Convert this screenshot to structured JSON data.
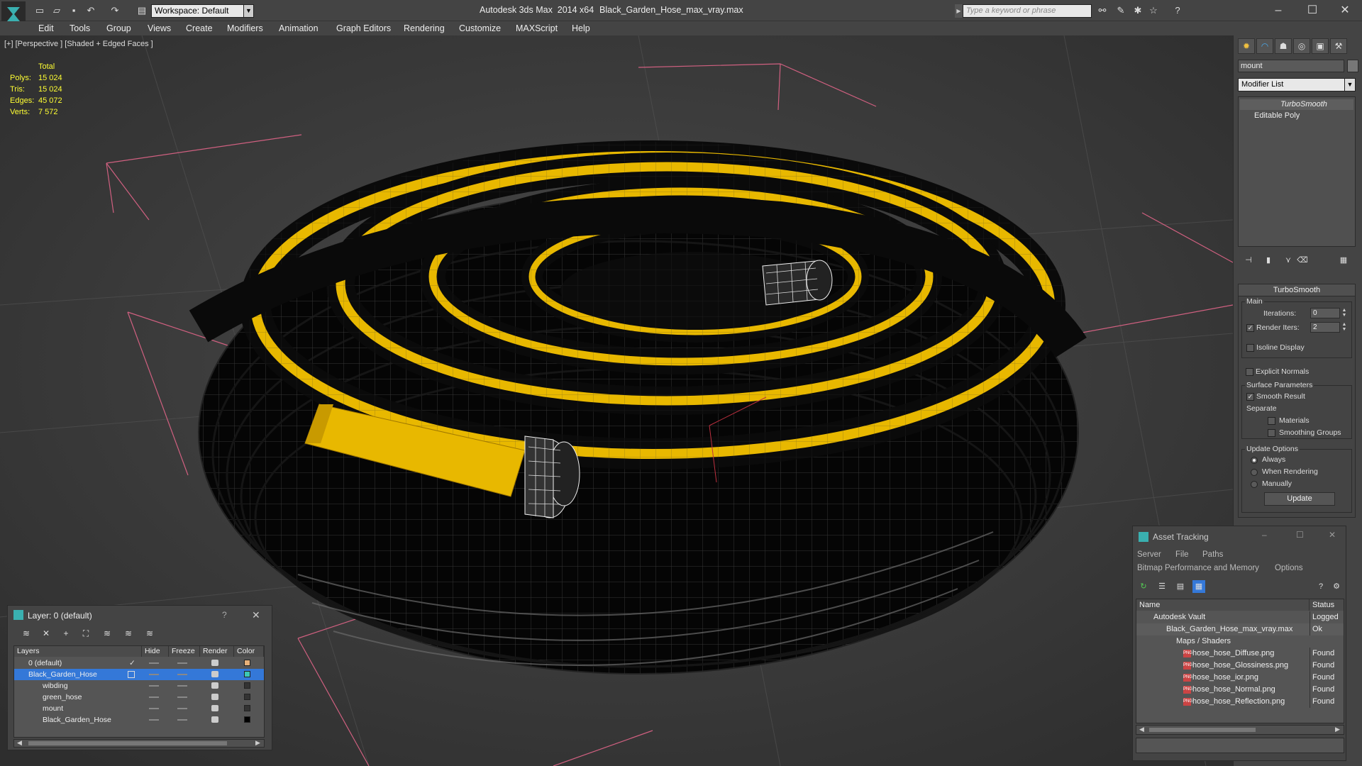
{
  "titlebar": {
    "app_title": "Autodesk 3ds Max  2014 x64",
    "file_name": "Black_Garden_Hose_max_vray.max",
    "workspace": "Workspace: Default",
    "search_placeholder": "Type a keyword or phrase",
    "minimize": "–",
    "maximize": "☐",
    "close": "✕"
  },
  "menu": [
    "Edit",
    "Tools",
    "Group",
    "Views",
    "Create",
    "Modifiers",
    "Animation",
    "Graph Editors",
    "Rendering",
    "Customize",
    "MAXScript",
    "Help"
  ],
  "viewport": {
    "label": "[+] [Perspective ] [Shaded + Edged Faces ]",
    "stats": {
      "header": "Total",
      "rows": [
        {
          "label": "Polys:",
          "value": "15 024"
        },
        {
          "label": "Tris:",
          "value": "15 024"
        },
        {
          "label": "Edges:",
          "value": "45 072"
        },
        {
          "label": "Verts:",
          "value": "7 572"
        }
      ]
    }
  },
  "command_panel": {
    "object_name": "mount",
    "modifier_list": "Modifier List",
    "stack": [
      "TurboSmooth",
      "Editable Poly"
    ],
    "turbosmooth": {
      "title": "TurboSmooth",
      "main_group": "Main",
      "iterations_label": "Iterations:",
      "iterations_value": "0",
      "render_iters_label": "Render Iters:",
      "render_iters_value": "2",
      "isoline_display": "Isoline Display",
      "explicit_normals": "Explicit Normals",
      "surface_params_group": "Surface Parameters",
      "smooth_result": "Smooth Result",
      "separate_label": "Separate",
      "materials": "Materials",
      "smoothing_groups": "Smoothing Groups",
      "update_group": "Update Options",
      "always": "Always",
      "when_rendering": "When Rendering",
      "manually": "Manually",
      "update_button": "Update"
    }
  },
  "layer_panel": {
    "title": "Layer: 0 (default)",
    "help": "?",
    "close": "✕",
    "columns": [
      "Layers",
      "Hide",
      "Freeze",
      "Render",
      "Color"
    ],
    "rows": [
      {
        "name": "0 (default)",
        "color": "#e8b078"
      },
      {
        "name": "Black_Garden_Hose",
        "color": "#3cc8b4"
      },
      {
        "name": "wibding",
        "color": "#333333"
      },
      {
        "name": "green_hose",
        "color": "#333333"
      },
      {
        "name": "mount",
        "color": "#333333"
      },
      {
        "name": "Black_Garden_Hose",
        "color": "#000000"
      }
    ]
  },
  "asset_tracking": {
    "title": "Asset Tracking",
    "menu1": [
      "Server",
      "File",
      "Paths"
    ],
    "menu2": [
      "Bitmap Performance and Memory",
      "Options"
    ],
    "columns": [
      "Name",
      "Status"
    ],
    "rows": [
      {
        "name": "Autodesk Vault",
        "status": "Logged O",
        "indent": 0
      },
      {
        "name": "Black_Garden_Hose_max_vray.max",
        "status": "Ok",
        "indent": 1
      },
      {
        "name": "Maps / Shaders",
        "status": "",
        "indent": 2
      },
      {
        "name": "hose_hose_Diffuse.png",
        "status": "Found",
        "indent": 3
      },
      {
        "name": "hose_hose_Glossiness.png",
        "status": "Found",
        "indent": 3
      },
      {
        "name": "hose_hose_ior.png",
        "status": "Found",
        "indent": 3
      },
      {
        "name": "hose_hose_Normal.png",
        "status": "Found",
        "indent": 3
      },
      {
        "name": "hose_hose_Reflection.png",
        "status": "Found",
        "indent": 3
      }
    ]
  },
  "colors": {
    "hose_yellow": "#e8b800",
    "hose_black": "#0a0a0a",
    "selection_blue": "#3478d8",
    "stats_yellow": "#ffff33",
    "grid_pink": "#d06080"
  }
}
